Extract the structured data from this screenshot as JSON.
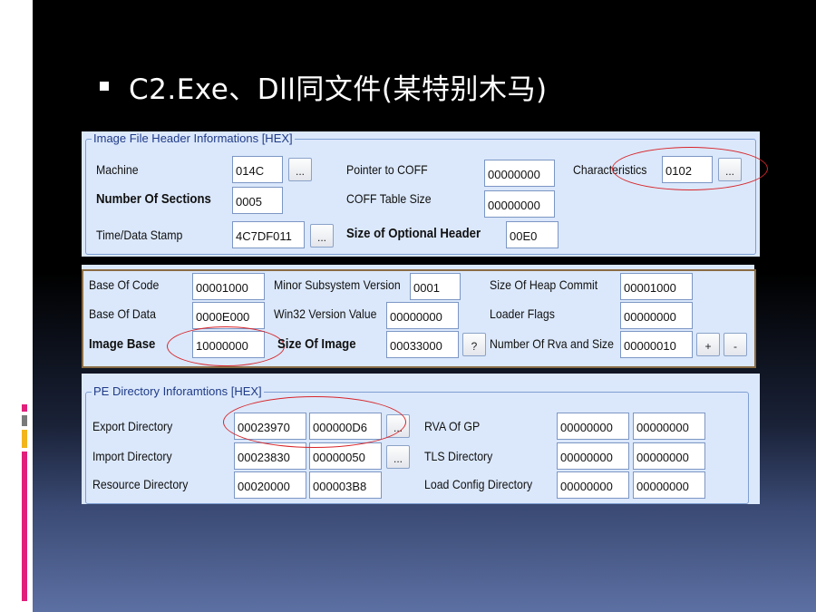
{
  "slide": {
    "title": "C2.Exe、Dll同文件(某特别木马)",
    "accent_colors": [
      "#e0207a",
      "#f2b61c",
      "#7a7a7a",
      "#e0207a"
    ]
  },
  "file_header": {
    "legend": "Image File Header Informations [HEX]",
    "machine_label": "Machine",
    "machine_value": "014C",
    "sections_label": "Number Of Sections",
    "sections_value": "0005",
    "timestamp_label": "Time/Data Stamp",
    "timestamp_value": "4C7DF011",
    "coff_ptr_label": "Pointer to COFF",
    "coff_ptr_value": "00000000",
    "coff_size_label": "COFF Table Size",
    "coff_size_value": "00000000",
    "opt_header_label": "Size of Optional Header",
    "opt_header_value": "00E0",
    "characteristics_label": "Characteristics",
    "characteristics_value": "0102",
    "more_button": "..."
  },
  "optional_header": {
    "base_code_label": "Base Of Code",
    "base_code_value": "00001000",
    "base_data_label": "Base Of Data",
    "base_data_value": "0000E000",
    "image_base_label": "Image Base",
    "image_base_value": "10000000",
    "minor_sub_label": "Minor Subsystem Version",
    "minor_sub_value": "0001",
    "win32_label": "Win32 Version Value",
    "win32_value": "00000000",
    "size_image_label": "Size Of Image",
    "size_image_value": "00033000",
    "help_button": "?",
    "heap_commit_label": "Size Of Heap Commit",
    "heap_commit_value": "00001000",
    "loader_flags_label": "Loader Flags",
    "loader_flags_value": "00000000",
    "rva_count_label": "Number Of Rva and Size",
    "rva_count_value": "00000010",
    "plus_button": "+",
    "minus_button": "-"
  },
  "directories": {
    "legend": "PE Directory Inforamtions [HEX]",
    "rows_left": [
      {
        "label": "Export Directory",
        "rva": "00023970",
        "size": "000000D6"
      },
      {
        "label": "Import Directory",
        "rva": "00023830",
        "size": "00000050"
      },
      {
        "label": "Resource Directory",
        "rva": "00020000",
        "size": "000003B8"
      }
    ],
    "rows_right": [
      {
        "label": "RVA Of GP",
        "rva": "00000000",
        "size": "00000000"
      },
      {
        "label": "TLS Directory",
        "rva": "00000000",
        "size": "00000000"
      },
      {
        "label": "Load Config Directory",
        "rva": "00000000",
        "size": "00000000"
      }
    ],
    "more_button": "..."
  }
}
